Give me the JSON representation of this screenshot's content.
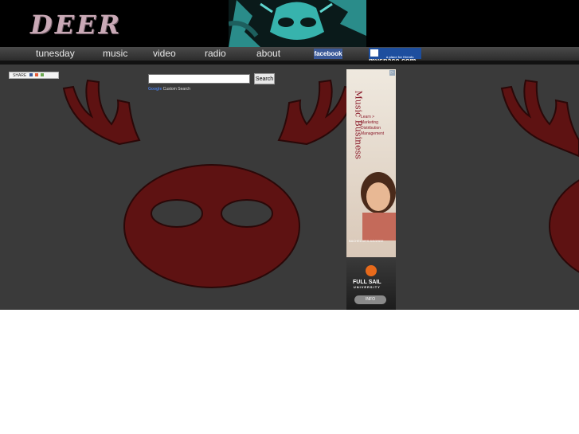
{
  "header": {
    "logo_text": "DEER"
  },
  "nav": {
    "items": [
      {
        "label": "tunesday"
      },
      {
        "label": "music"
      },
      {
        "label": "video"
      },
      {
        "label": "radio"
      },
      {
        "label": "about"
      }
    ],
    "facebook_label": "facebook",
    "myspace_label": "myspace.com",
    "myspace_tagline": "a place for friends"
  },
  "share": {
    "label": "SHARE"
  },
  "search": {
    "value": "",
    "button_label": "Search",
    "custom_search_brand": "Google",
    "custom_search_label": "Custom Search"
  },
  "ad": {
    "title": "Music Business",
    "learn_lines": [
      "Learn >",
      "Marketing",
      "Distribution",
      "Management"
    ],
    "degree": "BACHELOR'S DEGREE",
    "university": "FULL SAIL",
    "university_sub": "UNIVERSITY",
    "info_label": "INFO",
    "choices_icon": "adchoices-icon"
  },
  "colors": {
    "background": "#3a3a3a",
    "reindeer": "#5e1212",
    "reindeer_outline": "#2a0808",
    "header": "#000000"
  }
}
